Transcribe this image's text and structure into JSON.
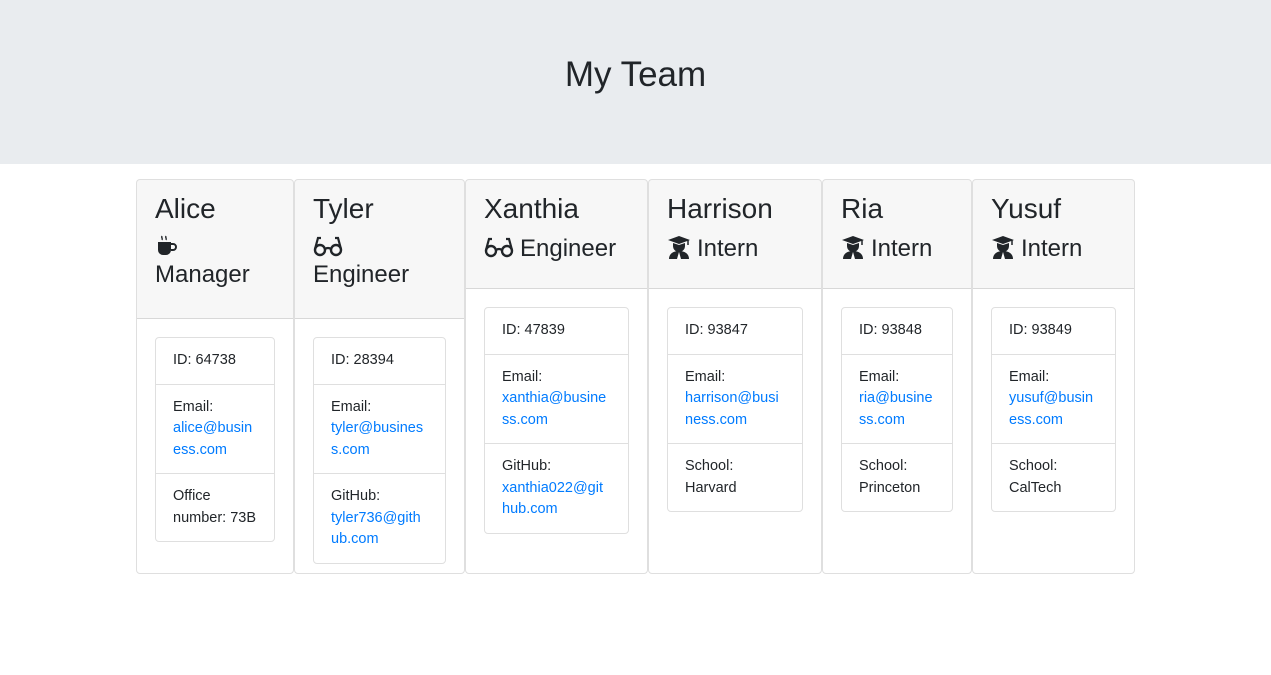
{
  "header": {
    "title": "My Team"
  },
  "team": [
    {
      "name": "Alice",
      "role": "Manager",
      "icon": "coffee-icon",
      "id": "ID: 64738",
      "email_label": "Email:",
      "email": "alice@business.com",
      "extra_label": "Office number:",
      "extra_value": "73B"
    },
    {
      "name": "Tyler",
      "role": "Engineer",
      "icon": "glasses-icon",
      "id": "ID: 28394",
      "email_label": "Email:",
      "email": "tyler@business.com",
      "extra_label": "GitHub:",
      "extra_value": "tyler736@github.com"
    },
    {
      "name": "Xanthia",
      "role": "Engineer",
      "icon": "glasses-icon",
      "id": "ID: 47839",
      "email_label": "Email:",
      "email": "xanthia@business.com",
      "extra_label": "GitHub:",
      "extra_value": "xanthia022@github.com"
    },
    {
      "name": "Harrison",
      "role": "Intern",
      "icon": "graduate-icon",
      "id": "ID: 93847",
      "email_label": "Email:",
      "email": "harrison@business.com",
      "extra_label": "School:",
      "extra_value": "Harvard"
    },
    {
      "name": "Ria",
      "role": "Intern",
      "icon": "graduate-icon",
      "id": "ID: 93848",
      "email_label": "Email:",
      "email": "ria@business.com",
      "extra_label": "School:",
      "extra_value": "Princeton"
    },
    {
      "name": "Yusuf",
      "role": "Intern",
      "icon": "graduate-icon",
      "id": "ID: 93849",
      "email_label": "Email:",
      "email": "yusuf@business.com",
      "extra_label": "School:",
      "extra_value": "CalTech"
    }
  ],
  "colors": {
    "header_bg": "#e9ecef",
    "link": "#007bff",
    "text": "#212529"
  }
}
